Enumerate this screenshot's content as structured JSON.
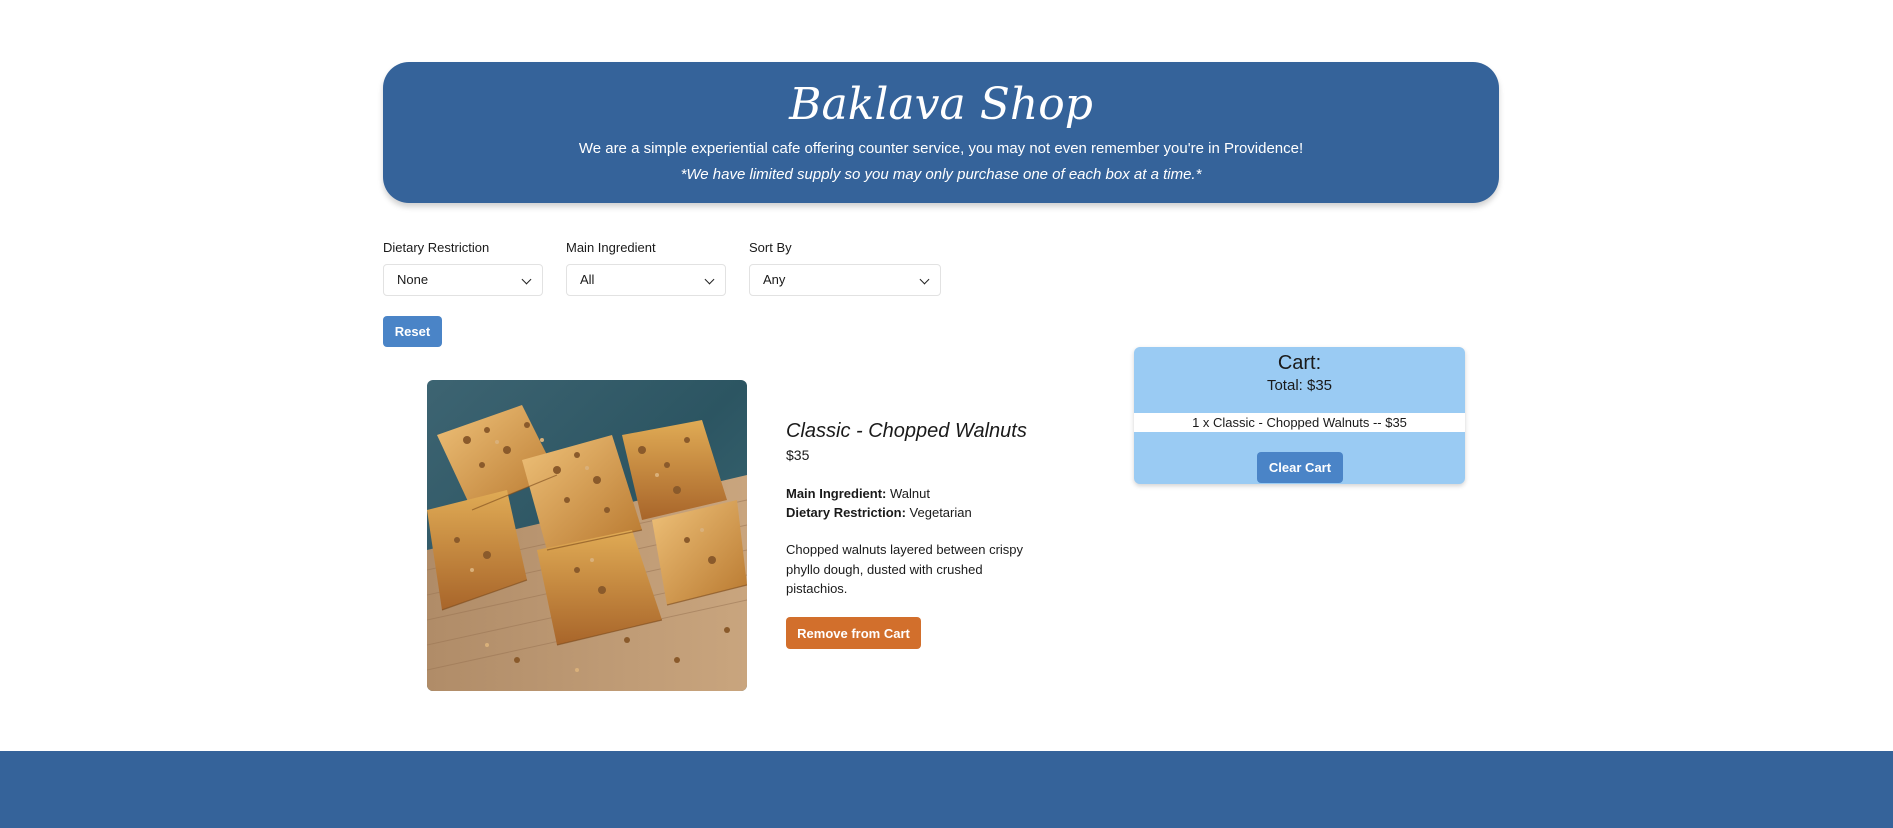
{
  "header": {
    "title": "Baklava Shop",
    "subtitle": "We are a simple experiential cafe offering counter service, you may not even remember you're in Providence!",
    "note": "*We have limited supply so you may only purchase one of each box at a time.*"
  },
  "filters": {
    "dietary": {
      "label": "Dietary Restriction",
      "value": "None"
    },
    "ingredient": {
      "label": "Main Ingredient",
      "value": "All"
    },
    "sort": {
      "label": "Sort By",
      "value": "Any"
    },
    "reset_label": "Reset"
  },
  "product": {
    "name": "Classic - Chopped Walnuts",
    "price": "$35",
    "main_ingredient_label": "Main Ingredient:",
    "main_ingredient": "Walnut",
    "dietary_label": "Dietary Restriction:",
    "dietary": "Vegetarian",
    "description": "Chopped walnuts layered between crispy phyllo dough, dusted with crushed pistachios.",
    "remove_label": "Remove from Cart"
  },
  "cart": {
    "title": "Cart:",
    "total": "Total: $35",
    "items": [
      "1 x Classic - Chopped Walnuts -- $35"
    ],
    "clear_label": "Clear Cart"
  },
  "colors": {
    "header_bg": "#35639a",
    "button_blue": "#4a84c7",
    "button_orange": "#d26f2c",
    "cart_bg": "#9acbf3"
  }
}
